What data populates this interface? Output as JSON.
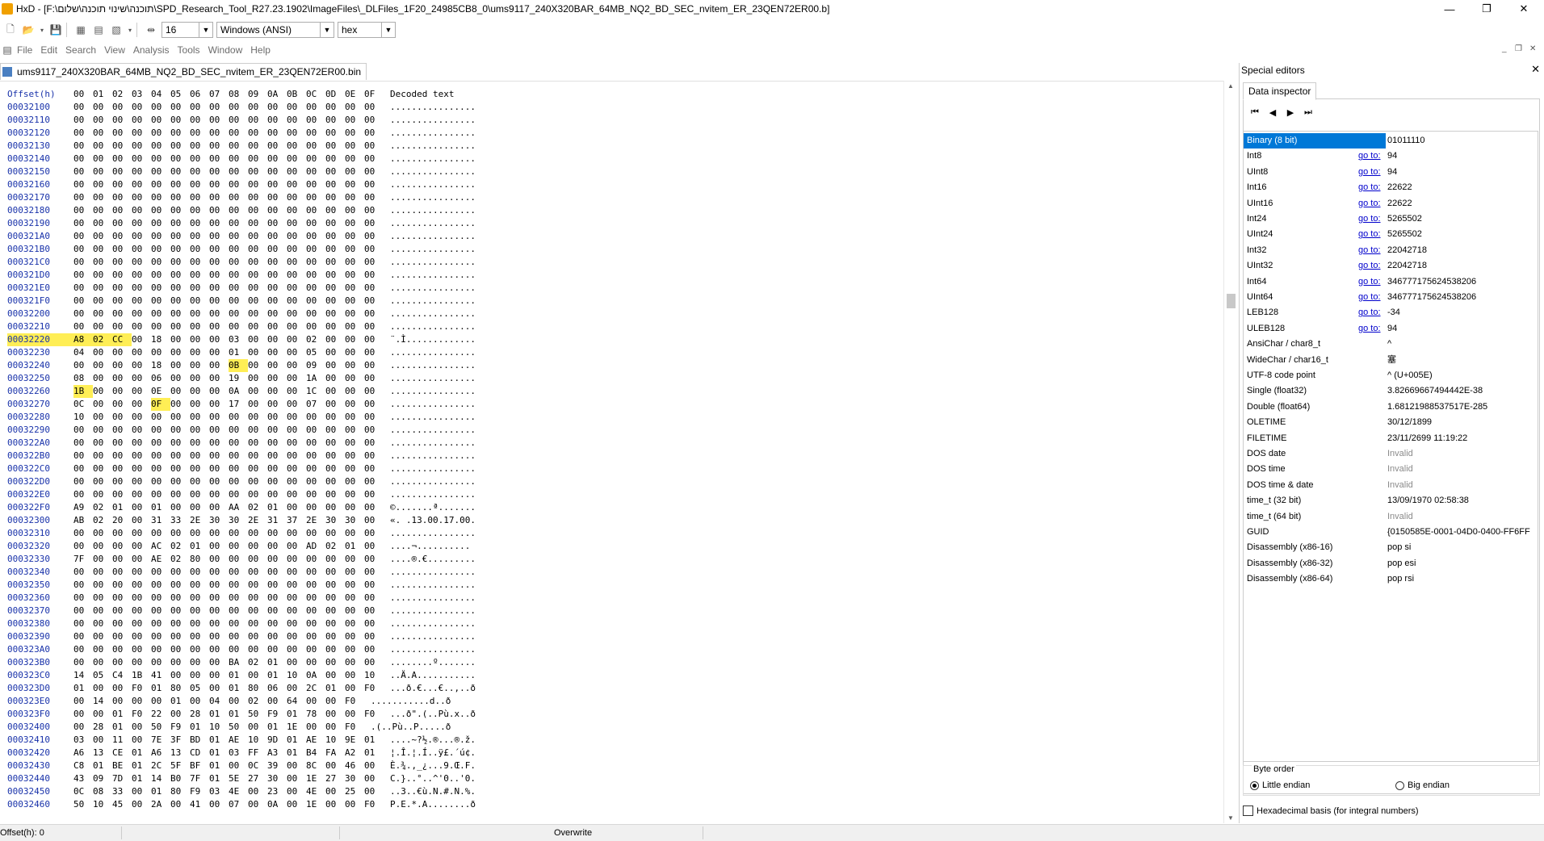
{
  "window": {
    "title": "HxD - [F:\\תוכנה\\שינוי תוכנה\\שלום\\SPD_Research_Tool_R27.23.1902\\ImageFiles\\_DLFiles_1F20_24985CB8_0\\ums9117_240X320BAR_64MB_NQ2_BD_SEC_nvitem_ER_23QEN72ER00.b]",
    "minimize": "—",
    "maximize": "❐",
    "close": "✕"
  },
  "toolbar": {
    "bytes_per_row": "16",
    "charset": "Windows (ANSI)",
    "offset_base": "hex"
  },
  "menu": [
    "File",
    "Edit",
    "Search",
    "View",
    "Analysis",
    "Tools",
    "Window",
    "Help"
  ],
  "document_tab": "ums9117_240X320BAR_64MB_NQ2_BD_SEC_nvitem_ER_23QEN72ER00.bin",
  "hex_header": {
    "offset_label": "Offset(h)",
    "columns": [
      "00",
      "01",
      "02",
      "03",
      "04",
      "05",
      "06",
      "07",
      "08",
      "09",
      "0A",
      "0B",
      "0C",
      "0D",
      "0E",
      "0F"
    ],
    "decoded_label": "Decoded text"
  },
  "hex_rows": [
    {
      "off": "00032100",
      "b": "00 00 00 00 00 00 00 00 00 00 00 00 00 00 00 00",
      "t": "................"
    },
    {
      "off": "00032110",
      "b": "00 00 00 00 00 00 00 00 00 00 00 00 00 00 00 00",
      "t": "................"
    },
    {
      "off": "00032120",
      "b": "00 00 00 00 00 00 00 00 00 00 00 00 00 00 00 00",
      "t": "................"
    },
    {
      "off": "00032130",
      "b": "00 00 00 00 00 00 00 00 00 00 00 00 00 00 00 00",
      "t": "................"
    },
    {
      "off": "00032140",
      "b": "00 00 00 00 00 00 00 00 00 00 00 00 00 00 00 00",
      "t": "................"
    },
    {
      "off": "00032150",
      "b": "00 00 00 00 00 00 00 00 00 00 00 00 00 00 00 00",
      "t": "................"
    },
    {
      "off": "00032160",
      "b": "00 00 00 00 00 00 00 00 00 00 00 00 00 00 00 00",
      "t": "................"
    },
    {
      "off": "00032170",
      "b": "00 00 00 00 00 00 00 00 00 00 00 00 00 00 00 00",
      "t": "................"
    },
    {
      "off": "00032180",
      "b": "00 00 00 00 00 00 00 00 00 00 00 00 00 00 00 00",
      "t": "................"
    },
    {
      "off": "00032190",
      "b": "00 00 00 00 00 00 00 00 00 00 00 00 00 00 00 00",
      "t": "................"
    },
    {
      "off": "000321A0",
      "b": "00 00 00 00 00 00 00 00 00 00 00 00 00 00 00 00",
      "t": "................"
    },
    {
      "off": "000321B0",
      "b": "00 00 00 00 00 00 00 00 00 00 00 00 00 00 00 00",
      "t": "................"
    },
    {
      "off": "000321C0",
      "b": "00 00 00 00 00 00 00 00 00 00 00 00 00 00 00 00",
      "t": "................"
    },
    {
      "off": "000321D0",
      "b": "00 00 00 00 00 00 00 00 00 00 00 00 00 00 00 00",
      "t": "................"
    },
    {
      "off": "000321E0",
      "b": "00 00 00 00 00 00 00 00 00 00 00 00 00 00 00 00",
      "t": "................"
    },
    {
      "off": "000321F0",
      "b": "00 00 00 00 00 00 00 00 00 00 00 00 00 00 00 00",
      "t": "................"
    },
    {
      "off": "00032200",
      "b": "00 00 00 00 00 00 00 00 00 00 00 00 00 00 00 00",
      "t": "................"
    },
    {
      "off": "00032210",
      "b": "00 00 00 00 00 00 00 00 00 00 00 00 00 00 00 00",
      "t": "................"
    },
    {
      "off": "00032220",
      "b": "A8 02 CC 00 18 00 00 00 03 00 00 00 02 00 00 00",
      "t": "¨.Ì............."
    },
    {
      "off": "00032230",
      "b": "04 00 00 00 00 00 00 00 01 00 00 00 05 00 00 00",
      "t": "................"
    },
    {
      "off": "00032240",
      "b": "00 00 00 00 18 00 00 00 0B 00 00 00 09 00 00 00",
      "t": "................"
    },
    {
      "off": "00032250",
      "b": "08 00 00 00 06 00 00 00 19 00 00 00 1A 00 00 00",
      "t": "................"
    },
    {
      "off": "00032260",
      "b": "1B 00 00 00 0E 00 00 00 0A 00 00 00 1C 00 00 00",
      "t": "................"
    },
    {
      "off": "00032270",
      "b": "0C 00 00 00 0F 00 00 00 17 00 00 00 07 00 00 00",
      "t": "................"
    },
    {
      "off": "00032280",
      "b": "10 00 00 00 00 00 00 00 00 00 00 00 00 00 00 00",
      "t": "................"
    },
    {
      "off": "00032290",
      "b": "00 00 00 00 00 00 00 00 00 00 00 00 00 00 00 00",
      "t": "................"
    },
    {
      "off": "000322A0",
      "b": "00 00 00 00 00 00 00 00 00 00 00 00 00 00 00 00",
      "t": "................"
    },
    {
      "off": "000322B0",
      "b": "00 00 00 00 00 00 00 00 00 00 00 00 00 00 00 00",
      "t": "................"
    },
    {
      "off": "000322C0",
      "b": "00 00 00 00 00 00 00 00 00 00 00 00 00 00 00 00",
      "t": "................"
    },
    {
      "off": "000322D0",
      "b": "00 00 00 00 00 00 00 00 00 00 00 00 00 00 00 00",
      "t": "................"
    },
    {
      "off": "000322E0",
      "b": "00 00 00 00 00 00 00 00 00 00 00 00 00 00 00 00",
      "t": "................"
    },
    {
      "off": "000322F0",
      "b": "A9 02 01 00 01 00 00 00 AA 02 01 00 00 00 00 00",
      "t": "©.......ª......."
    },
    {
      "off": "00032300",
      "b": "AB 02 20 00 31 33 2E 30 30 2E 31 37 2E 30 30 00",
      "t": "«. .13.00.17.00."
    },
    {
      "off": "00032310",
      "b": "00 00 00 00 00 00 00 00 00 00 00 00 00 00 00 00",
      "t": "................"
    },
    {
      "off": "00032320",
      "b": "00 00 00 00 AC 02 01 00 00 00 00 00 AD 02 01 00",
      "t": "....¬.......­..."
    },
    {
      "off": "00032330",
      "b": "7F 00 00 00 AE 02 80 00 00 00 00 00 00 00 00 00",
      "t": "....®.€........."
    },
    {
      "off": "00032340",
      "b": "00 00 00 00 00 00 00 00 00 00 00 00 00 00 00 00",
      "t": "................"
    },
    {
      "off": "00032350",
      "b": "00 00 00 00 00 00 00 00 00 00 00 00 00 00 00 00",
      "t": "................"
    },
    {
      "off": "00032360",
      "b": "00 00 00 00 00 00 00 00 00 00 00 00 00 00 00 00",
      "t": "................"
    },
    {
      "off": "00032370",
      "b": "00 00 00 00 00 00 00 00 00 00 00 00 00 00 00 00",
      "t": "................"
    },
    {
      "off": "00032380",
      "b": "00 00 00 00 00 00 00 00 00 00 00 00 00 00 00 00",
      "t": "................"
    },
    {
      "off": "00032390",
      "b": "00 00 00 00 00 00 00 00 00 00 00 00 00 00 00 00",
      "t": "................"
    },
    {
      "off": "000323A0",
      "b": "00 00 00 00 00 00 00 00 00 00 00 00 00 00 00 00",
      "t": "................"
    },
    {
      "off": "000323B0",
      "b": "00 00 00 00 00 00 00 00 BA 02 01 00 00 00 00 00",
      "t": "........º......."
    },
    {
      "off": "000323C0",
      "b": "14 05 C4 1B 41 00 00 00 01 00 01 10 0A 00 00 10",
      "t": "..Ä.A..........."
    },
    {
      "off": "000323D0",
      "b": "01 00 00 F0 01 80 05 00 01 80 06 00 2C 01 00 F0",
      "t": "...ð.€...€..,..ð"
    },
    {
      "off": "000323E0",
      "b": "00 14 00 00 00 01 00 04 00 02 00 64 00 00 F0",
      "t": "...........d..ð"
    },
    {
      "off": "000323F0",
      "b": "00 00 01 F0 22 00 28 01 01 50 F9 01 78 00 00 F0",
      "t": "...ð\".(..Pù.x..ð"
    },
    {
      "off": "00032400",
      "b": "00 28 01 00 50 F9 01 10 50 00 01 1E 00 00 F0",
      "t": ".(..Pù..P.....ð"
    },
    {
      "off": "00032410",
      "b": "03 00 11 00 7E 3F BD 01 AE 10 9D 01 AE 10 9E 01",
      "t": "....~?½.®...®.ž."
    },
    {
      "off": "00032420",
      "b": "A6 13 CE 01 A6 13 CD 01 03 FF A3 01 B4 FA A2 01",
      "t": "¦.Î.¦.Í..ÿ£.´ú¢."
    },
    {
      "off": "00032430",
      "b": "C8 01 BE 01 2C 5F BF 01 00 0C 39 00 8C 00 46 00",
      "t": "È.¾.,_¿...9.Œ.F."
    },
    {
      "off": "00032440",
      "b": "43 09 7D 01 14 B0 7F 01 5E 27 30 00 1E 27 30 00",
      "t": "C.}..°..^'0..'0."
    },
    {
      "off": "00032450",
      "b": "0C 08 33 00 01 80 F9 03 4E 00 23 00 4E 00 25 00",
      "t": "..3..€ù.N.#.N.%."
    },
    {
      "off": "00032460",
      "b": "50 10 45 00 2A 00 41 00 07 00 0A 00 1E 00 00 F0",
      "t": "P.E.*.A........ð"
    }
  ],
  "highlight": {
    "offset": "00032220",
    "bytes": [
      [
        18,
        0
      ],
      [
        18,
        1
      ],
      [
        18,
        2
      ],
      [
        20,
        8
      ],
      [
        22,
        0
      ],
      [
        23,
        4
      ]
    ]
  },
  "special_editors": {
    "title": "Special editors",
    "close": "✕",
    "tab": "Data inspector",
    "nav": [
      "⏮",
      "◀",
      "▶",
      "⏭"
    ],
    "goto_label": "go to:",
    "rows": [
      {
        "name": "Binary (8 bit)",
        "goto": false,
        "value": "01011110",
        "selected": true
      },
      {
        "name": "Int8",
        "goto": true,
        "value": "94"
      },
      {
        "name": "UInt8",
        "goto": true,
        "value": "94"
      },
      {
        "name": "Int16",
        "goto": true,
        "value": "22622"
      },
      {
        "name": "UInt16",
        "goto": true,
        "value": "22622"
      },
      {
        "name": "Int24",
        "goto": true,
        "value": "5265502"
      },
      {
        "name": "UInt24",
        "goto": true,
        "value": "5265502"
      },
      {
        "name": "Int32",
        "goto": true,
        "value": "22042718"
      },
      {
        "name": "UInt32",
        "goto": true,
        "value": "22042718"
      },
      {
        "name": "Int64",
        "goto": true,
        "value": "346777175624538206"
      },
      {
        "name": "UInt64",
        "goto": true,
        "value": "346777175624538206"
      },
      {
        "name": "LEB128",
        "goto": true,
        "value": "-34"
      },
      {
        "name": "ULEB128",
        "goto": true,
        "value": "94"
      },
      {
        "name": "AnsiChar / char8_t",
        "goto": false,
        "value": "^"
      },
      {
        "name": "WideChar / char16_t",
        "goto": false,
        "value": "塞"
      },
      {
        "name": "UTF-8 code point",
        "goto": false,
        "value": "^ (U+005E)"
      },
      {
        "name": "Single (float32)",
        "goto": false,
        "value": "3.82669667494442E-38"
      },
      {
        "name": "Double (float64)",
        "goto": false,
        "value": "1.68121988537517E-285"
      },
      {
        "name": "OLETIME",
        "goto": false,
        "value": "30/12/1899"
      },
      {
        "name": "FILETIME",
        "goto": false,
        "value": "23/11/2699 11:19:22"
      },
      {
        "name": "DOS date",
        "goto": false,
        "value": "Invalid",
        "invalid": true
      },
      {
        "name": "DOS time",
        "goto": false,
        "value": "Invalid",
        "invalid": true
      },
      {
        "name": "DOS time & date",
        "goto": false,
        "value": "Invalid",
        "invalid": true
      },
      {
        "name": "time_t (32 bit)",
        "goto": false,
        "value": "13/09/1970 02:58:38"
      },
      {
        "name": "time_t (64 bit)",
        "goto": false,
        "value": "Invalid",
        "invalid": true
      },
      {
        "name": "GUID",
        "goto": false,
        "value": "{0150585E-0001-04D0-0400-FF6FF"
      },
      {
        "name": "Disassembly (x86-16)",
        "goto": false,
        "value": "pop si"
      },
      {
        "name": "Disassembly (x86-32)",
        "goto": false,
        "value": "pop esi"
      },
      {
        "name": "Disassembly (x86-64)",
        "goto": false,
        "value": "pop rsi"
      }
    ],
    "byte_order": {
      "label": "Byte order",
      "little": "Little endian",
      "big": "Big endian",
      "selected": "little"
    },
    "hex_basis": "Hexadecimal basis (for integral numbers)"
  },
  "status": {
    "offset": "Offset(h): 0",
    "mode": "Overwrite"
  }
}
